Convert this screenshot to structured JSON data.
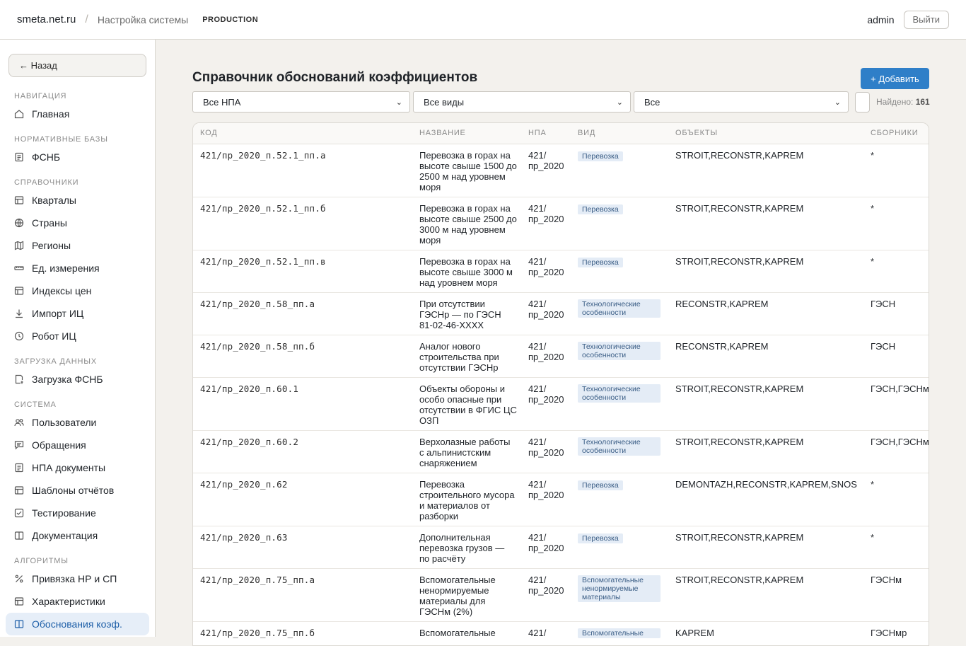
{
  "topbar": {
    "brand": "smeta.net.ru",
    "separator": "/",
    "crumb": "Настройка системы",
    "env": "PRODUCTION",
    "user": "admin",
    "logout": "Выйти"
  },
  "sidebar": {
    "back": "← Назад",
    "groups": [
      {
        "title": "НАВИГАЦИЯ",
        "items": [
          {
            "label": "Главная",
            "icon": "home-icon"
          }
        ]
      },
      {
        "title": "НОРМАТИВНЫЕ БАЗЫ",
        "items": [
          {
            "label": "ФСНБ",
            "icon": "document-icon"
          }
        ]
      },
      {
        "title": "СПРАВОЧНИКИ",
        "items": [
          {
            "label": "Кварталы",
            "icon": "table-icon"
          },
          {
            "label": "Страны",
            "icon": "globe-icon"
          },
          {
            "label": "Регионы",
            "icon": "map-icon"
          },
          {
            "label": "Ед. измерения",
            "icon": "ruler-icon"
          },
          {
            "label": "Индексы цен",
            "icon": "table-icon"
          },
          {
            "label": "Импорт ИЦ",
            "icon": "download-icon"
          },
          {
            "label": "Робот ИЦ",
            "icon": "clock-icon"
          }
        ]
      },
      {
        "title": "ЗАГРУЗКА ДАННЫХ",
        "items": [
          {
            "label": "Загрузка ФСНБ",
            "icon": "upload-file-icon"
          }
        ]
      },
      {
        "title": "СИСТЕМА",
        "items": [
          {
            "label": "Пользователи",
            "icon": "users-icon"
          },
          {
            "label": "Обращения",
            "icon": "message-icon"
          },
          {
            "label": "НПА документы",
            "icon": "document-icon"
          },
          {
            "label": "Шаблоны отчётов",
            "icon": "table-icon"
          },
          {
            "label": "Тестирование",
            "icon": "checkbox-icon"
          },
          {
            "label": "Документация",
            "icon": "book-icon"
          }
        ]
      },
      {
        "title": "АЛГОРИТМЫ",
        "items": [
          {
            "label": "Привязка НР и СП",
            "icon": "percent-icon"
          },
          {
            "label": "Характеристики",
            "icon": "table-icon"
          },
          {
            "label": "Обоснования коэф.",
            "icon": "book-icon",
            "active": true
          }
        ]
      }
    ]
  },
  "main": {
    "title": "Справочник обоснований коэффициентов",
    "add_button": "+ Добавить",
    "filters": {
      "npa": "Все НПА",
      "kind": "Все виды",
      "objects": "Все",
      "found_label": "Найдено:",
      "found_count": "161"
    },
    "columns": [
      "КОД",
      "НАЗВАНИЕ",
      "НПА",
      "ВИД",
      "ОБЪЕКТЫ",
      "СБОРНИКИ"
    ],
    "rows": [
      {
        "code": "421/пр_2020_п.52.1_пп.а",
        "name": "Перевозка в горах на высоте свыше 1500 до 2500 м над уровнем моря",
        "npa": "421/ пр_2020",
        "kind": "Перевозка",
        "objects": "STROIT,RECONSTR,KAPREM",
        "collections": "*"
      },
      {
        "code": "421/пр_2020_п.52.1_пп.б",
        "name": "Перевозка в горах на высоте свыше 2500 до 3000 м над уровнем моря",
        "npa": "421/ пр_2020",
        "kind": "Перевозка",
        "objects": "STROIT,RECONSTR,KAPREM",
        "collections": "*"
      },
      {
        "code": "421/пр_2020_п.52.1_пп.в",
        "name": "Перевозка в горах на высоте свыше 3000 м над уровнем моря",
        "npa": "421/ пр_2020",
        "kind": "Перевозка",
        "objects": "STROIT,RECONSTR,KAPREM",
        "collections": "*"
      },
      {
        "code": "421/пр_2020_п.58_пп.а",
        "name": "При отсутствии ГЭСНр — по ГЭСН 81-02-46-XXXX",
        "npa": "421/ пр_2020",
        "kind": "Технологические особенности",
        "objects": "RECONSTR,KAPREM",
        "collections": "ГЭСН"
      },
      {
        "code": "421/пр_2020_п.58_пп.б",
        "name": "Аналог нового строительства при отсутствии ГЭСНр",
        "npa": "421/ пр_2020",
        "kind": "Технологические особенности",
        "objects": "RECONSTR,KAPREM",
        "collections": "ГЭСН"
      },
      {
        "code": "421/пр_2020_п.60.1",
        "name": "Объекты обороны и особо опасные при отсутствии в ФГИС ЦС ОЗП",
        "npa": "421/ пр_2020",
        "kind": "Технологические особенности",
        "objects": "STROIT,RECONSTR,KAPREM",
        "collections": "ГЭСН,ГЭСНм"
      },
      {
        "code": "421/пр_2020_п.60.2",
        "name": "Верхолазные работы с альпинистским снаряжением",
        "npa": "421/ пр_2020",
        "kind": "Технологические особенности",
        "objects": "STROIT,RECONSTR,KAPREM",
        "collections": "ГЭСН,ГЭСНм"
      },
      {
        "code": "421/пр_2020_п.62",
        "name": "Перевозка строительного мусора и материалов от разборки",
        "npa": "421/ пр_2020",
        "kind": "Перевозка",
        "objects": "DEMONTAZH,RECONSTR,KAPREM,SNOS",
        "collections": "*"
      },
      {
        "code": "421/пр_2020_п.63",
        "name": "Дополнительная перевозка грузов — по расчёту",
        "npa": "421/ пр_2020",
        "kind": "Перевозка",
        "objects": "STROIT,RECONSTR,KAPREM",
        "collections": "*"
      },
      {
        "code": "421/пр_2020_п.75_пп.а",
        "name": "Вспомогательные ненормируемые материалы для ГЭСНм (2%)",
        "npa": "421/ пр_2020",
        "kind": "Вспомогательные ненормируемые материалы",
        "objects": "STROIT,RECONSTR,KAPREM",
        "collections": "ГЭСНм"
      },
      {
        "code": "421/пр_2020_п.75_пп.б",
        "name": "Вспомогательные",
        "npa": "421/",
        "kind": "Вспомогательные",
        "objects": "KAPREM",
        "collections": "ГЭСНмр"
      }
    ]
  }
}
